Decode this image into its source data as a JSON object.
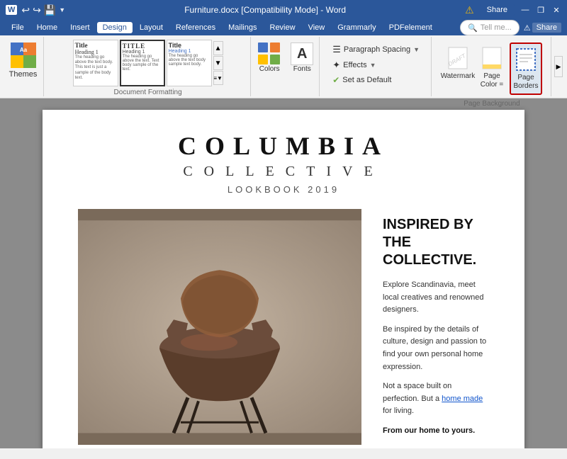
{
  "titleBar": {
    "wordIcon": "W",
    "quickAccess": [
      "↩",
      "↪",
      "💾"
    ],
    "title": "Furniture.docx [Compatibility Mode] - Word",
    "windowButtons": [
      "—",
      "❐",
      "✕"
    ]
  },
  "menuBar": {
    "items": [
      "File",
      "Home",
      "Insert",
      "Design",
      "Layout",
      "References",
      "Mailings",
      "Review",
      "View",
      "Grammarly",
      "PDFelement"
    ],
    "activeItem": "Design"
  },
  "ribbon": {
    "groups": [
      {
        "name": "themes",
        "label": "Themes",
        "button": "Themes"
      },
      {
        "name": "document-formatting",
        "label": "Document Formatting"
      },
      {
        "name": "colors-fonts",
        "colors_label": "Colors",
        "fonts_label": "Fonts"
      },
      {
        "name": "para-effects",
        "paraSpacing_label": "Paragraph Spacing",
        "effects_label": "Effects",
        "setDefault_label": "Set as Default"
      },
      {
        "name": "page-background",
        "label": "Page Background",
        "watermark_label": "Watermark",
        "pageColor_label": "Page\nColor",
        "pageBorders_label": "Page\nBorders"
      }
    ],
    "tellMe": {
      "placeholder": "Tell me...",
      "icon": "🔍"
    }
  },
  "document": {
    "titleMain": "COLUMBIA",
    "titleSub": "COLLECTIVE",
    "lookbook": "LOOKBOOK 2019",
    "heading": "INSPIRED BY\nTHE COLLECTIVE.",
    "paragraphs": [
      "Explore Scandinavia, meet local creatives and renowned designers.",
      "Be inspired by the details of culture, design and passion to find your own personal home expression.",
      "Not a space built on perfection. But a home made for living.",
      "From our home to yours."
    ],
    "linkText": "home made"
  },
  "colors": {
    "swatch1": "#4472c4",
    "swatch2": "#ed7d31",
    "swatch3": "#ffc000",
    "swatch4": "#70ad47"
  },
  "pageBackground": {
    "watermarkLabel": "Watermark",
    "pageColorLabel": "Page Color =",
    "pageBordersLabel": "Page Borders"
  }
}
